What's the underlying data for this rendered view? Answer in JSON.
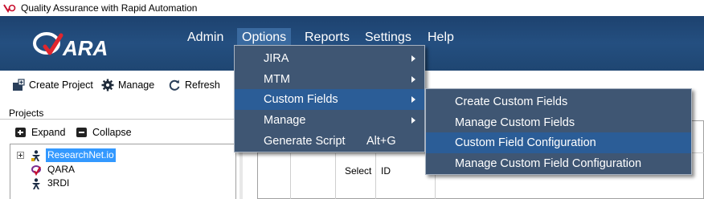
{
  "window": {
    "title": "Quality Assurance with Rapid Automation"
  },
  "logo": {
    "text": "QARA"
  },
  "menubar": {
    "items": [
      {
        "label": "Admin"
      },
      {
        "label": "Options"
      },
      {
        "label": "Reports"
      },
      {
        "label": "Settings"
      },
      {
        "label": "Help"
      }
    ]
  },
  "toolbar": {
    "create_project": "Create Project",
    "manage": "Manage",
    "refresh": "Refresh"
  },
  "projects_panel": {
    "title": "Projects",
    "expand": "Expand",
    "collapse": "Collapse",
    "tree": [
      {
        "label": "ResearchNet.io",
        "selected": true,
        "icon": "project-icon"
      },
      {
        "label": "QARA",
        "selected": false,
        "icon": "qara-project-icon"
      },
      {
        "label": "3RDI",
        "selected": false,
        "icon": "project-icon"
      }
    ]
  },
  "grid": {
    "columns": [
      "Select",
      "ID"
    ]
  },
  "options_menu": {
    "items": [
      {
        "label": "JIRA",
        "submenu": true
      },
      {
        "label": "MTM",
        "submenu": true
      },
      {
        "label": "Custom Fields",
        "submenu": true,
        "highlighted": true
      },
      {
        "label": "Manage",
        "submenu": true
      },
      {
        "label": "Generate Script",
        "shortcut": "Alt+G"
      }
    ]
  },
  "custom_fields_submenu": {
    "items": [
      {
        "label": "Create Custom Fields"
      },
      {
        "label": "Manage Custom Fields"
      },
      {
        "label": "Custom Field Configuration",
        "highlighted": true
      },
      {
        "label": "Manage Custom Field Configuration"
      }
    ]
  },
  "colors": {
    "header": "#244f80",
    "menu_bg": "#3f5673",
    "menu_highlight": "#2b5d97",
    "selection": "#3399ff"
  }
}
